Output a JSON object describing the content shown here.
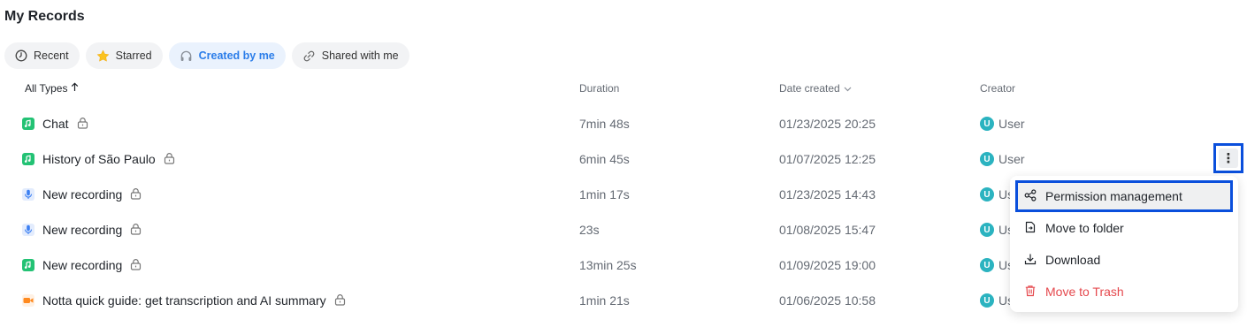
{
  "page": {
    "title": "My Records"
  },
  "filters": [
    {
      "label": "Recent",
      "icon": "clock-icon",
      "active": false
    },
    {
      "label": "Starred",
      "icon": "star-icon",
      "active": false
    },
    {
      "label": "Created by me",
      "icon": "headphones-icon",
      "active": true
    },
    {
      "label": "Shared with me",
      "icon": "link-icon",
      "active": false
    }
  ],
  "table": {
    "headers": {
      "types": "All Types",
      "duration": "Duration",
      "date": "Date created",
      "creator": "Creator"
    },
    "rows": [
      {
        "name": "Chat",
        "type_icon": "audio-file-icon",
        "duration": "7min 48s",
        "date": "01/23/2025 20:25",
        "creator_initial": "U",
        "creator": "User"
      },
      {
        "name": "History of São Paulo",
        "type_icon": "audio-file-icon",
        "duration": "6min 45s",
        "date": "01/07/2025 12:25",
        "creator_initial": "U",
        "creator": "User"
      },
      {
        "name": "New recording",
        "type_icon": "microphone-icon",
        "duration": "1min 17s",
        "date": "01/23/2025 14:43",
        "creator_initial": "U",
        "creator": "Us"
      },
      {
        "name": "New recording",
        "type_icon": "microphone-icon",
        "duration": "23s",
        "date": "01/08/2025 15:47",
        "creator_initial": "U",
        "creator": "Us"
      },
      {
        "name": "New recording",
        "type_icon": "audio-file-icon",
        "duration": "13min 25s",
        "date": "01/09/2025 19:00",
        "creator_initial": "U",
        "creator": "Us"
      },
      {
        "name": "Notta quick guide: get transcription and AI summary",
        "type_icon": "video-icon",
        "duration": "1min 21s",
        "date": "01/06/2025 10:58",
        "creator_initial": "U",
        "creator": "Us"
      }
    ]
  },
  "context_menu": {
    "more_glyph": "⋮",
    "items": [
      {
        "label": "Permission management",
        "icon": "share-nodes-icon"
      },
      {
        "label": "Move to folder",
        "icon": "folder-file-icon"
      },
      {
        "label": "Download",
        "icon": "download-icon"
      },
      {
        "label": "Move to Trash",
        "icon": "trash-icon"
      }
    ]
  },
  "colors": {
    "accent": "#2b7de9",
    "active_chip_bg": "#eaf2fd",
    "audio_icon": "#23c274",
    "mic_icon": "#3b7ff2",
    "video_icon": "#ff8a1f",
    "avatar": "#2bb3c0",
    "danger": "#e5484d",
    "highlight_border": "#0a4fdc"
  }
}
